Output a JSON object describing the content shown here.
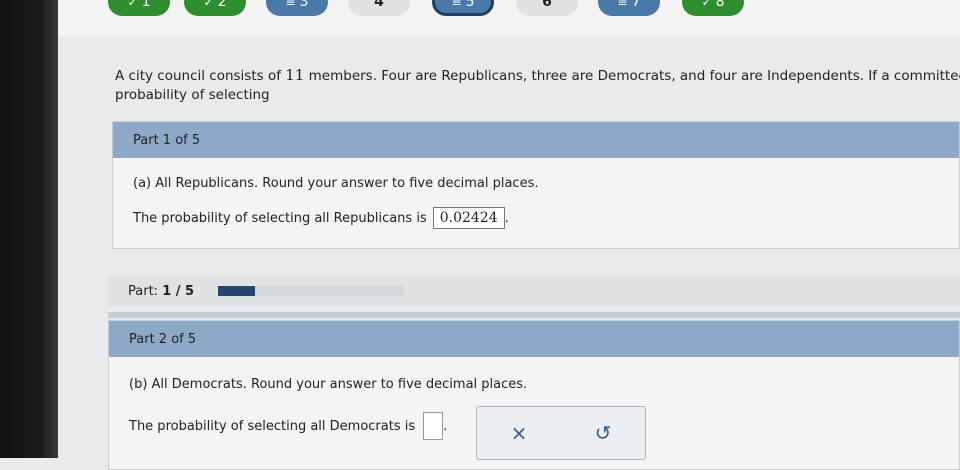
{
  "nav": {
    "items": [
      {
        "label": "1",
        "mark": "✓",
        "state": "done"
      },
      {
        "label": "2",
        "mark": "✓",
        "state": "done"
      },
      {
        "label": "3",
        "mark": "≡",
        "state": "part"
      },
      {
        "label": "4",
        "mark": "",
        "state": "empty"
      },
      {
        "label": "5",
        "mark": "≡",
        "state": "current"
      },
      {
        "label": "6",
        "mark": "",
        "state": "empty"
      },
      {
        "label": "7",
        "mark": "≡",
        "state": "part"
      },
      {
        "label": "8",
        "mark": "✓",
        "state": "done"
      }
    ]
  },
  "question": {
    "line1_a": "A city council consists of ",
    "line1_num": "11",
    "line1_b": " members. Four are Republicans, three are Democrats, and four are Independents. If a committee of t",
    "line2": "probability of selecting"
  },
  "part1": {
    "header": "Part 1 of 5",
    "prompt": "(a) All Republicans. Round your answer to five decimal places.",
    "answer_label": "The probability of selecting all Republicans is",
    "answer_value": "0.02424",
    "answer_suffix": "."
  },
  "progress": {
    "label": "Part:",
    "value": "1 / 5",
    "fraction": 0.2
  },
  "part2": {
    "header": "Part 2 of 5",
    "prompt": "(b) All Democrats. Round your answer to five decimal places.",
    "answer_label": "The probability of selecting all Democrats is",
    "answer_value": "",
    "answer_suffix": "."
  },
  "actions": {
    "clear_icon": "×",
    "undo_icon": "↺"
  }
}
